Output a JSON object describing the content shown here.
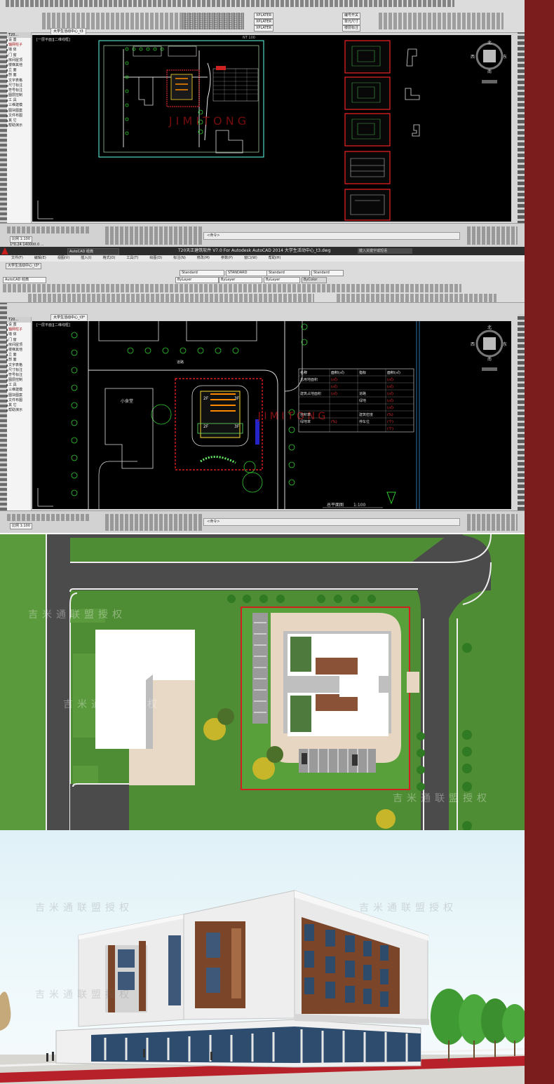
{
  "window1": {
    "file_tab": "大学生活动中心_t3",
    "tpanel_title": "T20...",
    "tpanel_items": [
      "设 置",
      "轴网柱子",
      "墙 体",
      "门 窗",
      "房间屋顶",
      "楼梯其他",
      "立 面",
      "剖 面",
      "文字表格",
      "尺寸标注",
      "符号标注",
      "图层控制",
      "工 具",
      "三维建模",
      "图块图案",
      "文件布图",
      "其 它",
      "帮助演示"
    ],
    "tpanel_red": [
      "轴网柱子",
      "墙体",
      "门窗"
    ],
    "view_label": "[一层平面][二维线框]",
    "compass": {
      "north": "北",
      "south": "南",
      "east": "东",
      "west": "西",
      "center": "上"
    },
    "layer_chips": [
      "XPLATER",
      "XPLATER",
      "XPLATER"
    ],
    "panel_chips": [
      "编号开关",
      "单元尺寸",
      "楼层标注"
    ],
    "frame_label": "NT 100",
    "wcs_label": "WCS",
    "coords": "1*0.24  140000.0 ...",
    "scale": "比例 1:100",
    "cmd_placeholder": "<命令>"
  },
  "window2": {
    "title": "T20天正建筑软件 V7.0 For Autodesk AutoCAD 2014    大学生活动中心_t3.dwg",
    "workspace": "AutoCAD 经典",
    "search_placeholder": "键入关键字或短语",
    "menu": [
      "文件(F)",
      "编辑(E)",
      "视图(V)",
      "插入(I)",
      "格式(O)",
      "工具(T)",
      "绘图(D)",
      "标注(N)",
      "修改(M)",
      "参数(P)",
      "窗口(W)",
      "帮助(H)"
    ],
    "styles": [
      "Standard",
      "STANDARD",
      "Standard",
      "Standard"
    ],
    "layer_props": [
      "ByLayer",
      "ByLayer",
      "ByLayer",
      "ByColor"
    ],
    "workspace2": "AutoCAD 经典",
    "file_tab": "大学生活动中心_t3*",
    "tpanel_title": "T20...",
    "view_label": "[一层平面][二维线框]",
    "plan_title": "总平面图",
    "plan_scale": "1:100",
    "room_labels": [
      "2F",
      "3F",
      "2F",
      "3F"
    ],
    "existing_label": "小食堂",
    "road_label": "道路",
    "table_header": [
      "名称",
      "面积(㎡)",
      "指标",
      "面积(㎡)"
    ],
    "table_rows": [
      [
        "总用地面积",
        "(㎡)",
        "",
        "(㎡)"
      ],
      [
        "",
        "(㎡)",
        "",
        "(㎡)"
      ],
      [
        "建筑占地面积",
        "(㎡)",
        "道路",
        "(㎡)"
      ],
      [
        "",
        "",
        "绿地",
        "(㎡)"
      ],
      [
        "",
        "",
        "",
        "(㎡)"
      ],
      [
        "容积率",
        "",
        "建筑密度",
        "(%)"
      ],
      [
        "绿地率",
        "(%)",
        "停车位",
        "(个)"
      ],
      [
        "",
        "",
        "",
        "(个)"
      ]
    ],
    "scale": "比例 1:100",
    "cmd_placeholder": "<命令>"
  },
  "siteplan": {
    "watermarks": [
      "吉米通联盟授权",
      "吉米通联盟授权",
      "吉米通联盟授权"
    ]
  },
  "render3d": {
    "watermarks": [
      "吉米通联盟授权",
      "吉米通联盟授权",
      "吉米通联盟授权"
    ]
  },
  "cad_watermark": "J I M I T O N G",
  "colors": {
    "accent_red": "#7b1d1d",
    "cad_canvas": "#000000",
    "grass": "#4d8a33",
    "road": "#4b4b4b",
    "facade_wood": "#7a4528"
  }
}
